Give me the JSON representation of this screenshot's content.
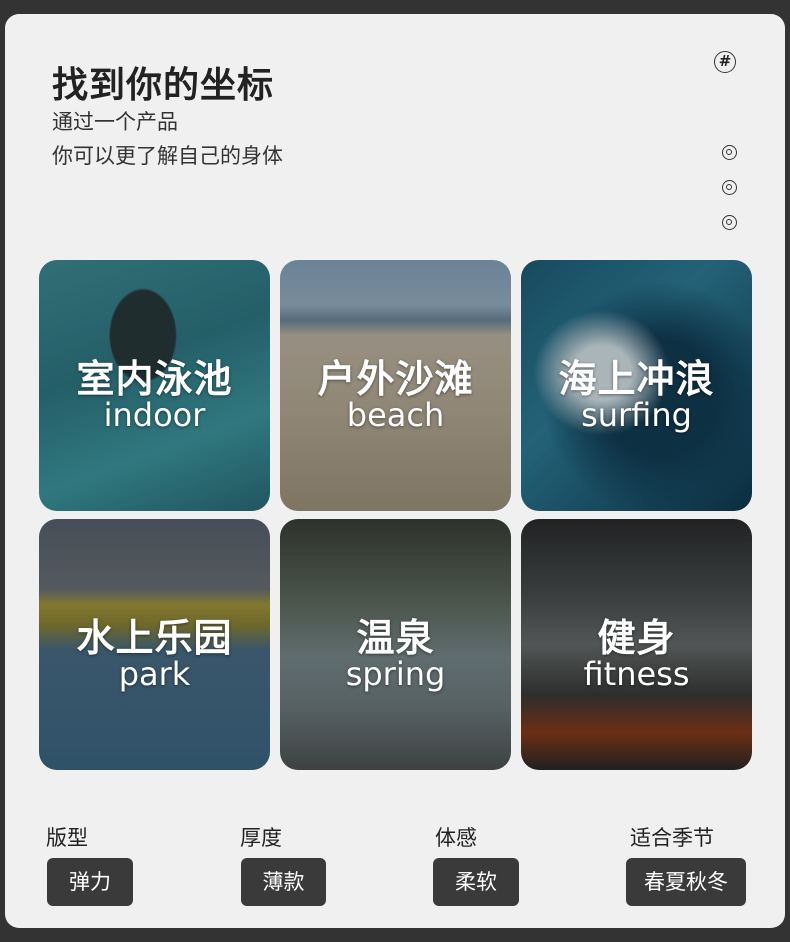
{
  "header": {
    "title": "找到你的坐标",
    "subtitle_line1": "通过一个产品",
    "subtitle_line2": "你可以更了解自己的身体",
    "corner_icon": "hash-circle-icon",
    "side_icons": [
      "target-icon",
      "target-icon",
      "target-icon"
    ]
  },
  "tiles": [
    {
      "zh": "室内泳池",
      "en": "indoor"
    },
    {
      "zh": "户外沙滩",
      "en": "beach"
    },
    {
      "zh": "海上冲浪",
      "en": "surfing"
    },
    {
      "zh": "水上乐园",
      "en": "park"
    },
    {
      "zh": "温泉",
      "en": "spring"
    },
    {
      "zh": "健身",
      "en": "fitness"
    }
  ],
  "specs": [
    {
      "label": "版型",
      "value": "弹力"
    },
    {
      "label": "厚度",
      "value": "薄款"
    },
    {
      "label": "体感",
      "value": "柔软"
    },
    {
      "label": "适合季节",
      "value": "春夏秋冬"
    }
  ],
  "colors": {
    "page_background": "#333333",
    "card_background": "#f0f0f0",
    "pill_background": "#3a3a3a"
  }
}
